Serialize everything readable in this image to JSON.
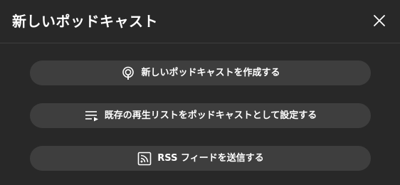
{
  "dialog": {
    "title": "新しいポッドキャスト",
    "close_icon": "close-icon",
    "options": [
      {
        "label": "新しいポッドキャストを作成する",
        "icon": "podcast-icon"
      },
      {
        "label": "既存の再生リストをポッドキャストとして設定する",
        "icon": "playlist-icon"
      },
      {
        "label": "RSS フィードを送信する",
        "icon": "rss-icon"
      }
    ]
  },
  "colors": {
    "background": "#282828",
    "button": "#3e3e3e",
    "divider": "#3f3f3f",
    "text": "#ffffff"
  }
}
